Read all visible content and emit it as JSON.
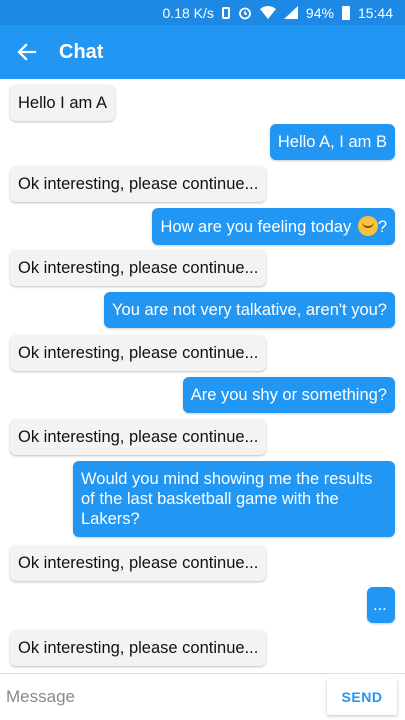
{
  "status_bar": {
    "speed": "0.18 K/s",
    "battery": "94%",
    "time": "15:44"
  },
  "app_bar": {
    "title": "Chat",
    "back_icon": "arrow-back-icon"
  },
  "messages": [
    {
      "from": "A",
      "text": "Hello I am A"
    },
    {
      "from": "B",
      "text": "Hello A, I am B"
    },
    {
      "from": "A",
      "text": "Ok interesting, please continue..."
    },
    {
      "from": "B",
      "text": "How are you feeling today",
      "emoji": "smiling-face",
      "suffix": "?"
    },
    {
      "from": "A",
      "text": "Ok interesting, please continue..."
    },
    {
      "from": "B",
      "text": "You are not very talkative, aren't you?"
    },
    {
      "from": "A",
      "text": "Ok interesting, please continue..."
    },
    {
      "from": "B",
      "text": "Are you shy or something?"
    },
    {
      "from": "A",
      "text": "Ok interesting, please continue..."
    },
    {
      "from": "B",
      "text": "Would you mind showing me the results of the last basketball game with the Lakers?"
    },
    {
      "from": "A",
      "text": "Ok interesting, please continue..."
    },
    {
      "from": "B",
      "text": "..."
    },
    {
      "from": "A",
      "text": "Ok interesting, please continue..."
    }
  ],
  "composer": {
    "placeholder": "Message",
    "send_label": "SEND"
  },
  "colors": {
    "status_bar": "#1e88e5",
    "app_bar": "#2196f3",
    "sent_bubble": "#2196f3",
    "received_bubble": "#f3f3f3"
  }
}
